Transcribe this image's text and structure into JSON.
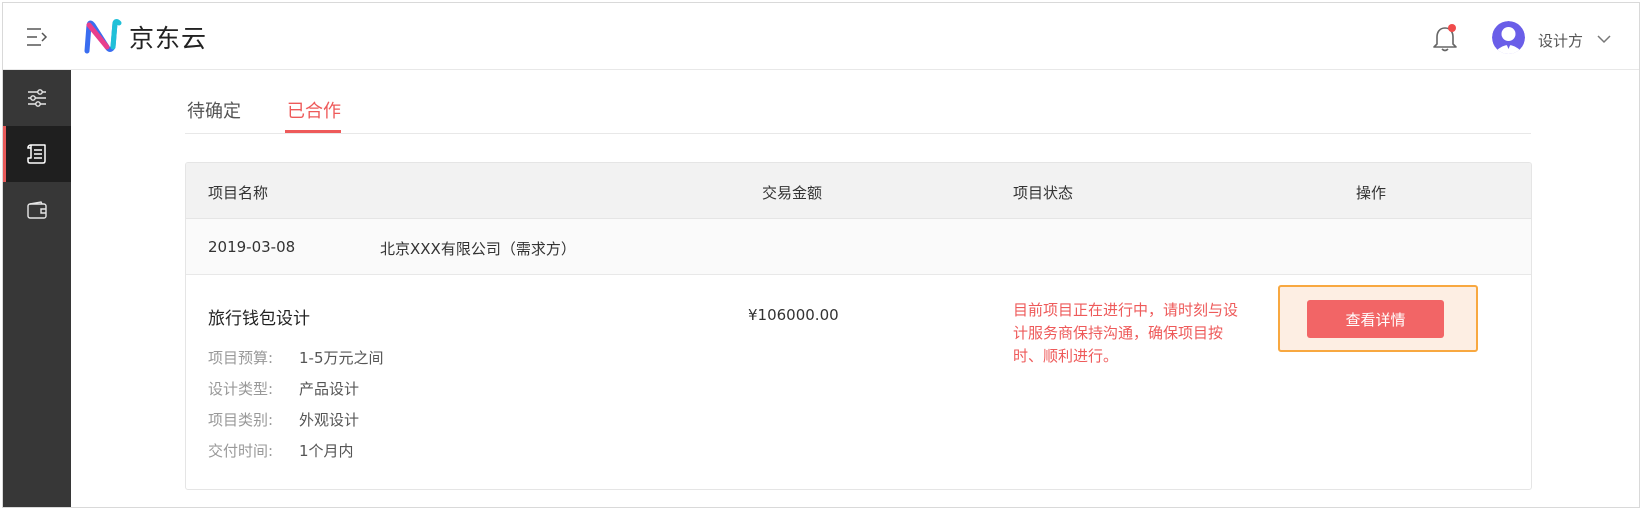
{
  "header": {
    "logo_text": "京东云",
    "user_name": "设计方",
    "notification_dot_color": "#f04b4b"
  },
  "sidebar": {
    "items": [
      {
        "icon": "sliders-icon"
      },
      {
        "icon": "document-list-icon",
        "active": true
      },
      {
        "icon": "wallet-icon"
      }
    ]
  },
  "tabs": [
    {
      "label": "待确定"
    },
    {
      "label": "已合作",
      "active": true
    }
  ],
  "table": {
    "columns": [
      "项目名称",
      "交易金额",
      "项目状态",
      "操作"
    ],
    "group": {
      "date": "2019-03-08",
      "company": "北京XXX有限公司（需求方）"
    },
    "row": {
      "title": "旅行钱包设计",
      "amount": "¥106000.00",
      "status": "目前项目正在进行中，请时刻与设计服务商保持沟通，确保项目按时、顺利进行。",
      "details": [
        {
          "label": "项目预算:",
          "value": "1-5万元之间"
        },
        {
          "label": "设计类型:",
          "value": "产品设计"
        },
        {
          "label": "项目类别:",
          "value": "外观设计"
        },
        {
          "label": "交付时间:",
          "value": "1个月内"
        }
      ],
      "action_label": "查看详情"
    }
  },
  "colors": {
    "accent": "#ee5a5a",
    "sidebar_bg": "#373737",
    "button_bg": "#f26566",
    "highlight_border": "#f8a840"
  }
}
